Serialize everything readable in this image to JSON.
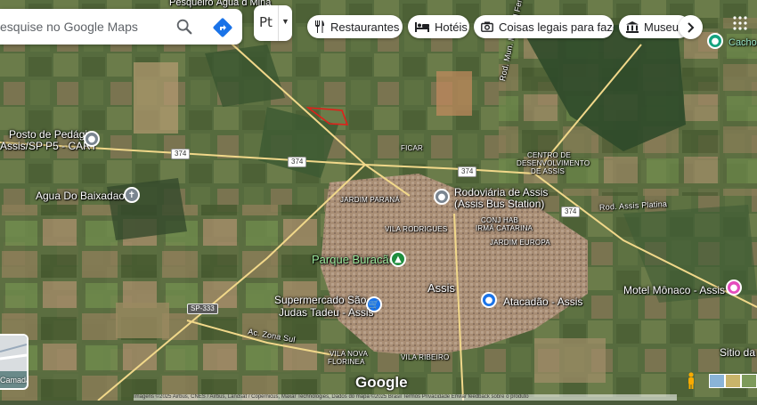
{
  "search": {
    "placeholder": "esquise no Google Maps",
    "value": ""
  },
  "language": {
    "label": "Pt"
  },
  "chips": [
    {
      "label": "Restaurantes",
      "icon": "restaurant-icon"
    },
    {
      "label": "Hotéis",
      "icon": "hotel-icon"
    },
    {
      "label": "Coisas legais para fazer",
      "icon": "camera-icon"
    },
    {
      "label": "Museus",
      "icon": "museum-icon"
    }
  ],
  "places": {
    "pesqueiro": "Pesqueiro Água d Mina",
    "cachoeira": "Cacho",
    "posto_line1": "Posto de Pedágio",
    "posto_line2": "Assis/SP P5 - CART",
    "agua_baixadao": "Agua Do Baixadao",
    "rodoviaria_line1": "Rodoviária de Assis",
    "rodoviaria_line2": "(Assis Bus Station)",
    "parque": "Parque Buracão",
    "supermercado_line1": "Supermercado São",
    "supermercado_line2": "Judas Tadeu - Assis",
    "atacadao": "Atacadão - Assis",
    "motel": "Motel Mônaco - Assis",
    "sitio": "Sitio da",
    "city": "Assis"
  },
  "areas": {
    "ficar": "FICAR",
    "distrito_1": "CENTRO DE",
    "distrito_2": "DESENVOLVIMENTO",
    "distrito_3": "DE ASSIS",
    "jardim_parana": "JARDIM PARANÁ",
    "conj_hab_1": "CONJ HAB",
    "conj_hab_2": "IRMÃ CATARINA",
    "vila_rodrigues": "VILA RODRIGUES",
    "jardim_europa": "JARDIM EUROPA",
    "vila_nova_1": "VILA NOVA",
    "vila_nova_2": "FLORINEA",
    "vila_ribeiro": "VILA RIBEIRO"
  },
  "roads": {
    "rod_manoel": "Rod. Mun. Manoel Fern",
    "rod_platina": "Rod. Assis Platina",
    "zona_sul": "Ac. Zona Sul",
    "r374_a": "374",
    "r374_b": "374",
    "r374_c": "374",
    "r374_d": "374",
    "sp333": "SP-333"
  },
  "layers": {
    "label": "Camadas"
  },
  "logo": "Google",
  "attribution": "Imagens ©2025 Airbus, CNES / Airbus, Landsat / Copernicus, Maxar Technologies, Dados do mapa ©2025   Brasil   Termos   Privacidade   Enviar feedback sobre o produto",
  "colors": {
    "satellite_base": "#4a5a3a",
    "road": "#f1d88a",
    "city": "#a89078",
    "parcel_outline": "#e0201a"
  }
}
